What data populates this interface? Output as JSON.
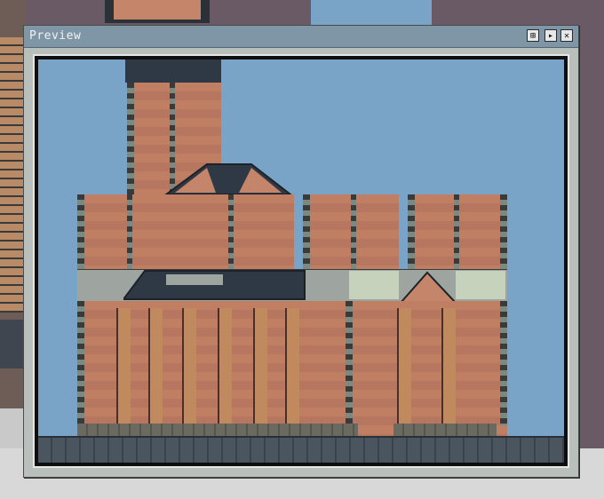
{
  "window": {
    "title": "Preview",
    "buttons": [
      {
        "label": "⊞",
        "icon": "fit-icon"
      },
      {
        "label": "▸",
        "icon": "play-icon"
      },
      {
        "label": "✕",
        "icon": "close-icon"
      }
    ]
  },
  "colors": {
    "sky": "#7aa3c8",
    "brick": "#c07f63",
    "roof": "#2e3945",
    "titlebar": "#7e96a6"
  }
}
